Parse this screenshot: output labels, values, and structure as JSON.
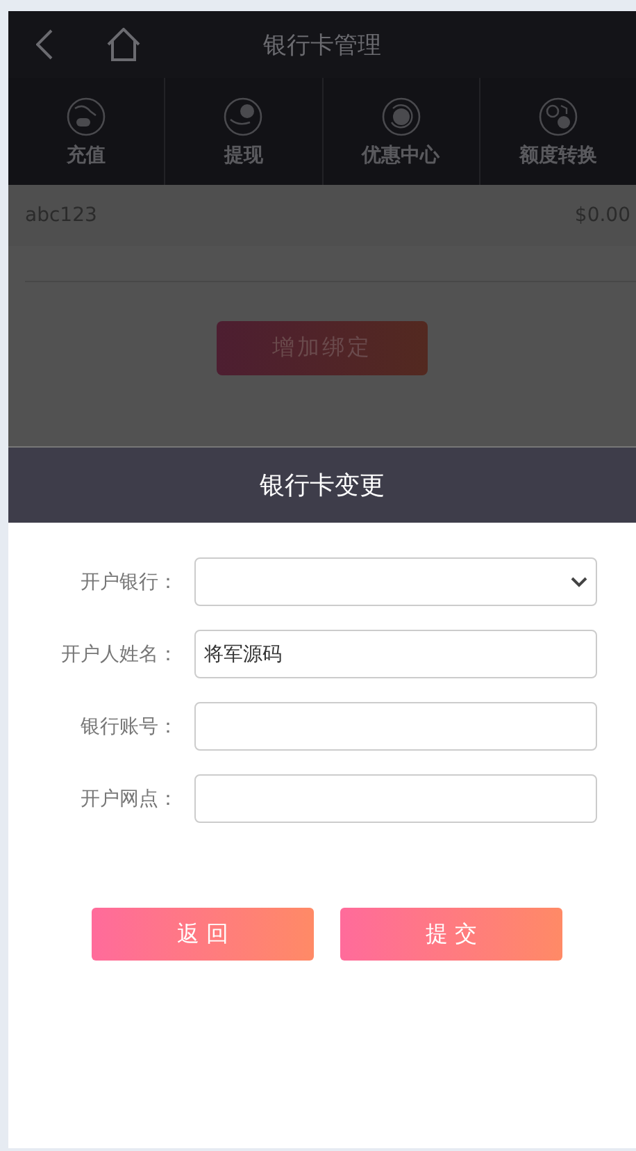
{
  "header": {
    "title": "银行卡管理"
  },
  "nav": [
    {
      "label": "充值"
    },
    {
      "label": "提现"
    },
    {
      "label": "优惠中心"
    },
    {
      "label": "额度转换"
    }
  ],
  "account": {
    "name": "abc123",
    "balance": "$0.00"
  },
  "bind_button": "增加绑定",
  "dialog": {
    "title": "银行卡变更",
    "fields": [
      {
        "label": "开户银行：",
        "kind": "select"
      },
      {
        "label": "开户人姓名：",
        "kind": "text",
        "value": "将军源码"
      },
      {
        "label": "银行账号：",
        "kind": "text"
      },
      {
        "label": "开户网点：",
        "kind": "text"
      }
    ],
    "buttons": [
      "返 回",
      "提 交"
    ]
  }
}
